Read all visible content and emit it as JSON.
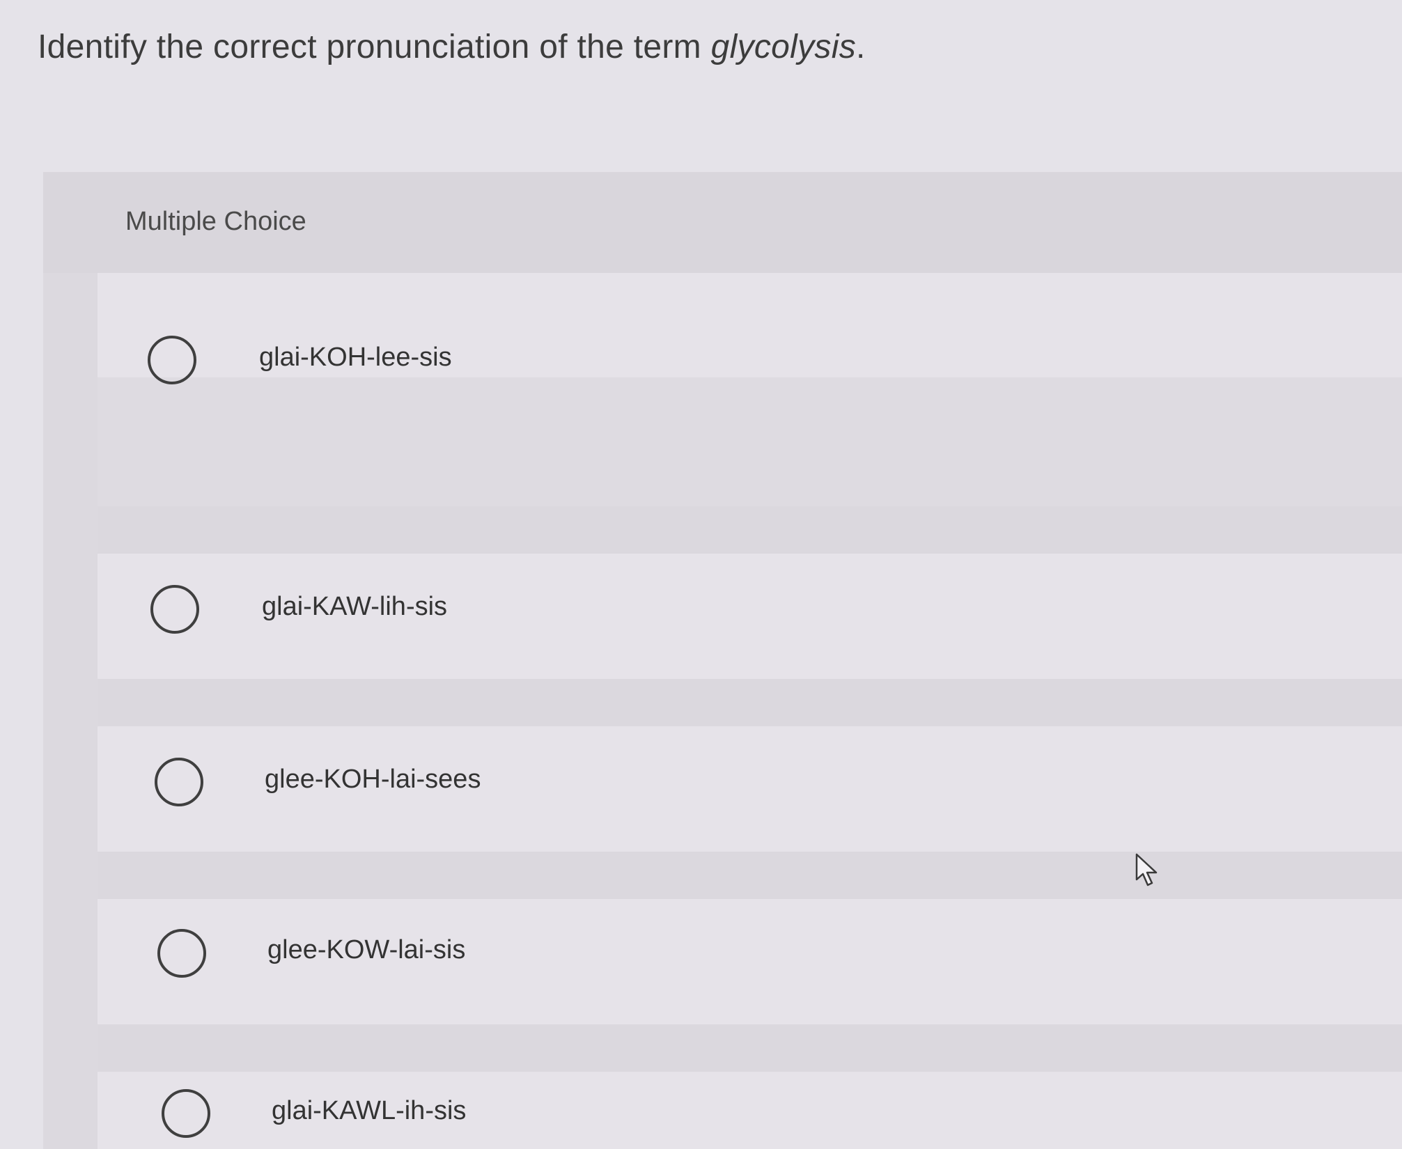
{
  "question": {
    "prefix": "Identify the correct pronunciation of the term ",
    "term": "glycolysis",
    "suffix": "."
  },
  "mc": {
    "label": "Multiple Choice",
    "options": [
      {
        "text": "glai-KOH-lee-sis"
      },
      {
        "text": "glai-KAW-lih-sis"
      },
      {
        "text": "glee-KOH-lai-sees"
      },
      {
        "text": "glee-KOW-lai-sis"
      },
      {
        "text": "glai-KAWL-ih-sis"
      }
    ]
  }
}
